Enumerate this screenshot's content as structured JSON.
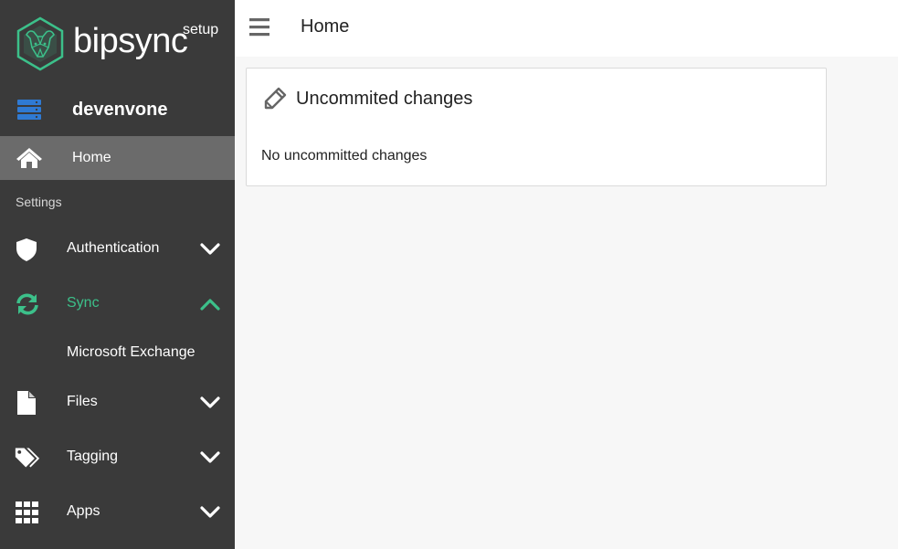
{
  "brand": {
    "name": "bipsync",
    "badge": "setup",
    "accent": "#3cc08a"
  },
  "sidebar": {
    "server": {
      "label": "devenvone",
      "icon": "server-icon"
    },
    "home": {
      "label": "Home",
      "icon": "home-icon"
    },
    "section_title": "Settings",
    "items": [
      {
        "label": "Authentication",
        "icon": "shield-icon",
        "expanded": false
      },
      {
        "label": "Sync",
        "icon": "sync-icon",
        "expanded": true
      },
      {
        "label": "Files",
        "icon": "file-icon",
        "expanded": false
      },
      {
        "label": "Tagging",
        "icon": "tags-icon",
        "expanded": false
      },
      {
        "label": "Apps",
        "icon": "grid-icon",
        "expanded": false
      }
    ],
    "sync_subitems": [
      {
        "label": "Microsoft Exchange"
      }
    ]
  },
  "header": {
    "title": "Home",
    "menu_icon": "hamburger-icon"
  },
  "main": {
    "card": {
      "title": "Uncommited changes",
      "icon": "pencil-icon",
      "message": "No uncommitted changes"
    }
  },
  "colors": {
    "sidebar_bg": "#3a3a3a",
    "sidebar_active_bg": "#6b6b6b",
    "server_icon": "#2f7ad3",
    "content_bg": "#f7f7f7"
  }
}
